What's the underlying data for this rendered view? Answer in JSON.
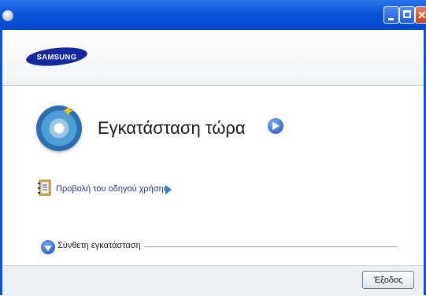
{
  "header": {
    "logo_text": "SAMSUNG"
  },
  "main": {
    "install_now_label": "Εγκατάσταση τώρα",
    "user_guide_label": "Προβολή του οδηγού χρήσης",
    "advanced_install_label": "Σύνθετη εγκατάσταση"
  },
  "footer": {
    "exit_label": "Έξοδος"
  },
  "colors": {
    "titlebar": "#0a54da",
    "brand_blue": "#1428a0",
    "link": "#1f3b8e"
  }
}
